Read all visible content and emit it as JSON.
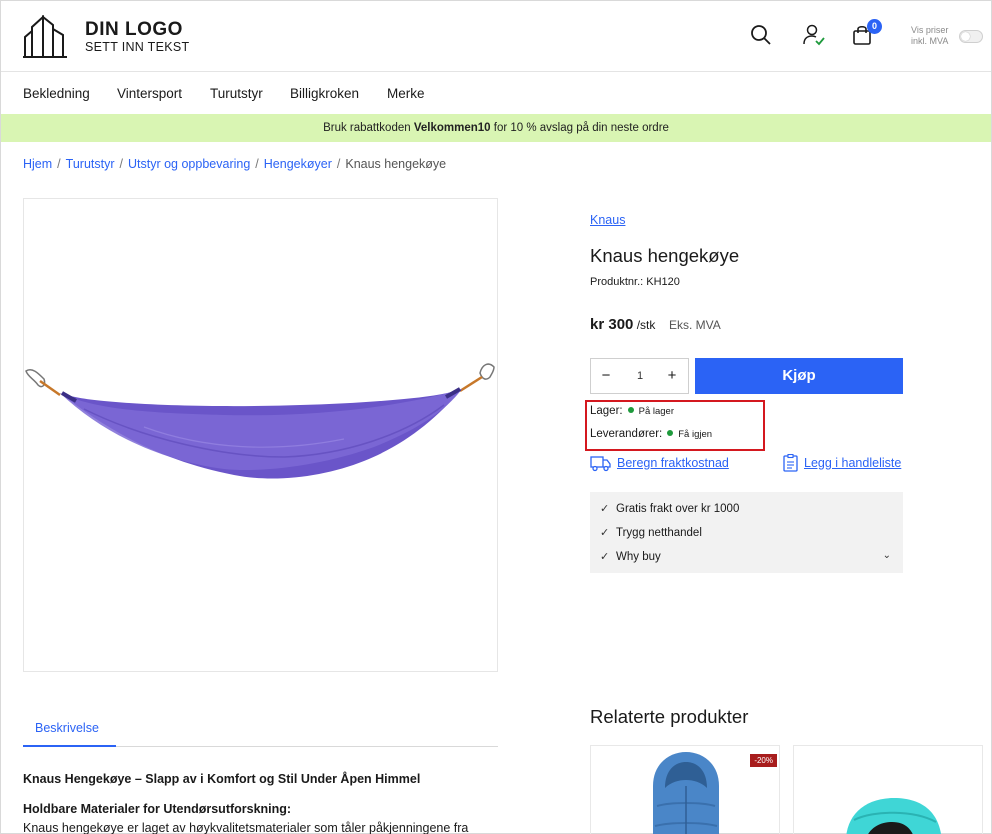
{
  "header": {
    "logo_title": "DIN LOGO",
    "logo_sub": "SETT INN TEKST",
    "cart_count": "0",
    "vat_label_line1": "Vis priser",
    "vat_label_line2": "inkl. MVA"
  },
  "nav": {
    "items": [
      "Bekledning",
      "Vintersport",
      "Turutstyr",
      "Billigkroken",
      "Merke"
    ]
  },
  "promo": {
    "before": "Bruk rabattkoden ",
    "code": "Velkommen10",
    "after": " for 10 % avslag på din neste ordre"
  },
  "breadcrumb": {
    "items": [
      "Hjem",
      "Turutstyr",
      "Utstyr og oppbevaring",
      "Hengekøyer"
    ],
    "current": "Knaus hengekøye"
  },
  "product": {
    "brand": "Knaus",
    "title": "Knaus hengekøye",
    "number": "Produktnr.: KH120",
    "price": "kr 300",
    "price_unit": " /stk",
    "price_tax": "Eks. MVA",
    "quantity": "1",
    "minus": "−",
    "plus": "+",
    "buy_label": "Kjøp",
    "stock_label": "Lager:",
    "stock_status": "På lager",
    "supplier_label": "Leverandører:",
    "supplier_status": "Få igjen",
    "shipping_link": "Beregn fraktkostnad",
    "shoppinglist_link": "Legg i handleliste"
  },
  "benefits": {
    "items": [
      "Gratis frakt over kr 1000",
      "Trygg netthandel",
      "Why buy"
    ]
  },
  "tabs": {
    "description": "Beskrivelse"
  },
  "description": {
    "title": "Knaus Hengekøye – Slapp av i Komfort og Stil Under Åpen Himmel",
    "subtitle": "Holdbare Materialer for Utendørsutforskning:",
    "text": "Knaus hengekøye er laget av høykvalitetsmaterialer som tåler påkjenningene fra"
  },
  "related": {
    "title": "Relaterte produkter",
    "badge": "-20%"
  },
  "colors": {
    "accent": "#2b63f5",
    "promo_bg": "#d9f5b3",
    "in_stock": "#1e9a3c",
    "highlight_box": "#d4181f",
    "hammock": "#6a55c9"
  }
}
